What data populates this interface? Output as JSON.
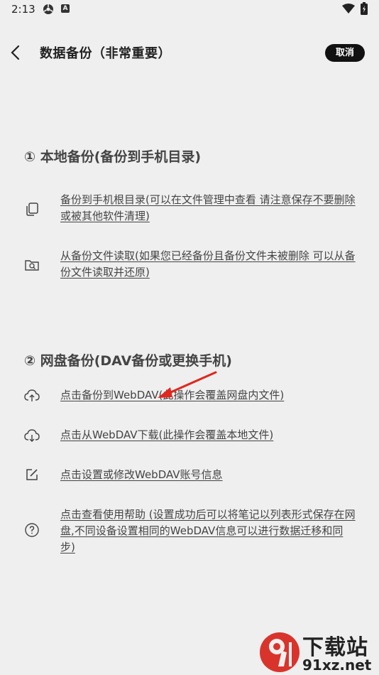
{
  "status_bar": {
    "time": "2:13",
    "app_badge": "A"
  },
  "header": {
    "title": "数据备份（非常重要）",
    "cancel_label": "取消"
  },
  "local_section": {
    "title": "① 本地备份(备份到手机目录)",
    "items": [
      {
        "icon": "copy-icon",
        "text": "备份到手机根目录(可以在文件管理中查看 请注意保存不要删除或被其他软件清理)"
      },
      {
        "icon": "folder-search-icon",
        "text": "从备份文件读取(如果您已经备份且备份文件未被删除 可以从备份文件读取并还原)"
      }
    ]
  },
  "cloud_section": {
    "title": "② 网盘备份(DAV备份或更换手机)",
    "items": [
      {
        "icon": "cloud-upload-icon",
        "text": "点击备份到WebDAV(此操作会覆盖网盘内文件)"
      },
      {
        "icon": "cloud-download-icon",
        "text": "点击从WebDAV下载(此操作会覆盖本地文件)"
      },
      {
        "icon": "edit-icon",
        "text": "点击设置或修改WebDAV账号信息"
      },
      {
        "icon": "help-icon",
        "text": "点击查看使用帮助 (设置成功后可以将笔记以列表形式保存在网盘,不同设备设置相同的WebDAV信息可以进行数据迁移和同步)"
      }
    ]
  },
  "watermark": {
    "line1": "下载站",
    "line2": "91xz.net"
  },
  "colors": {
    "accent": "#111111",
    "background": "#efefef",
    "arrow": "#e0281e",
    "watermark_red": "#d9342b"
  }
}
